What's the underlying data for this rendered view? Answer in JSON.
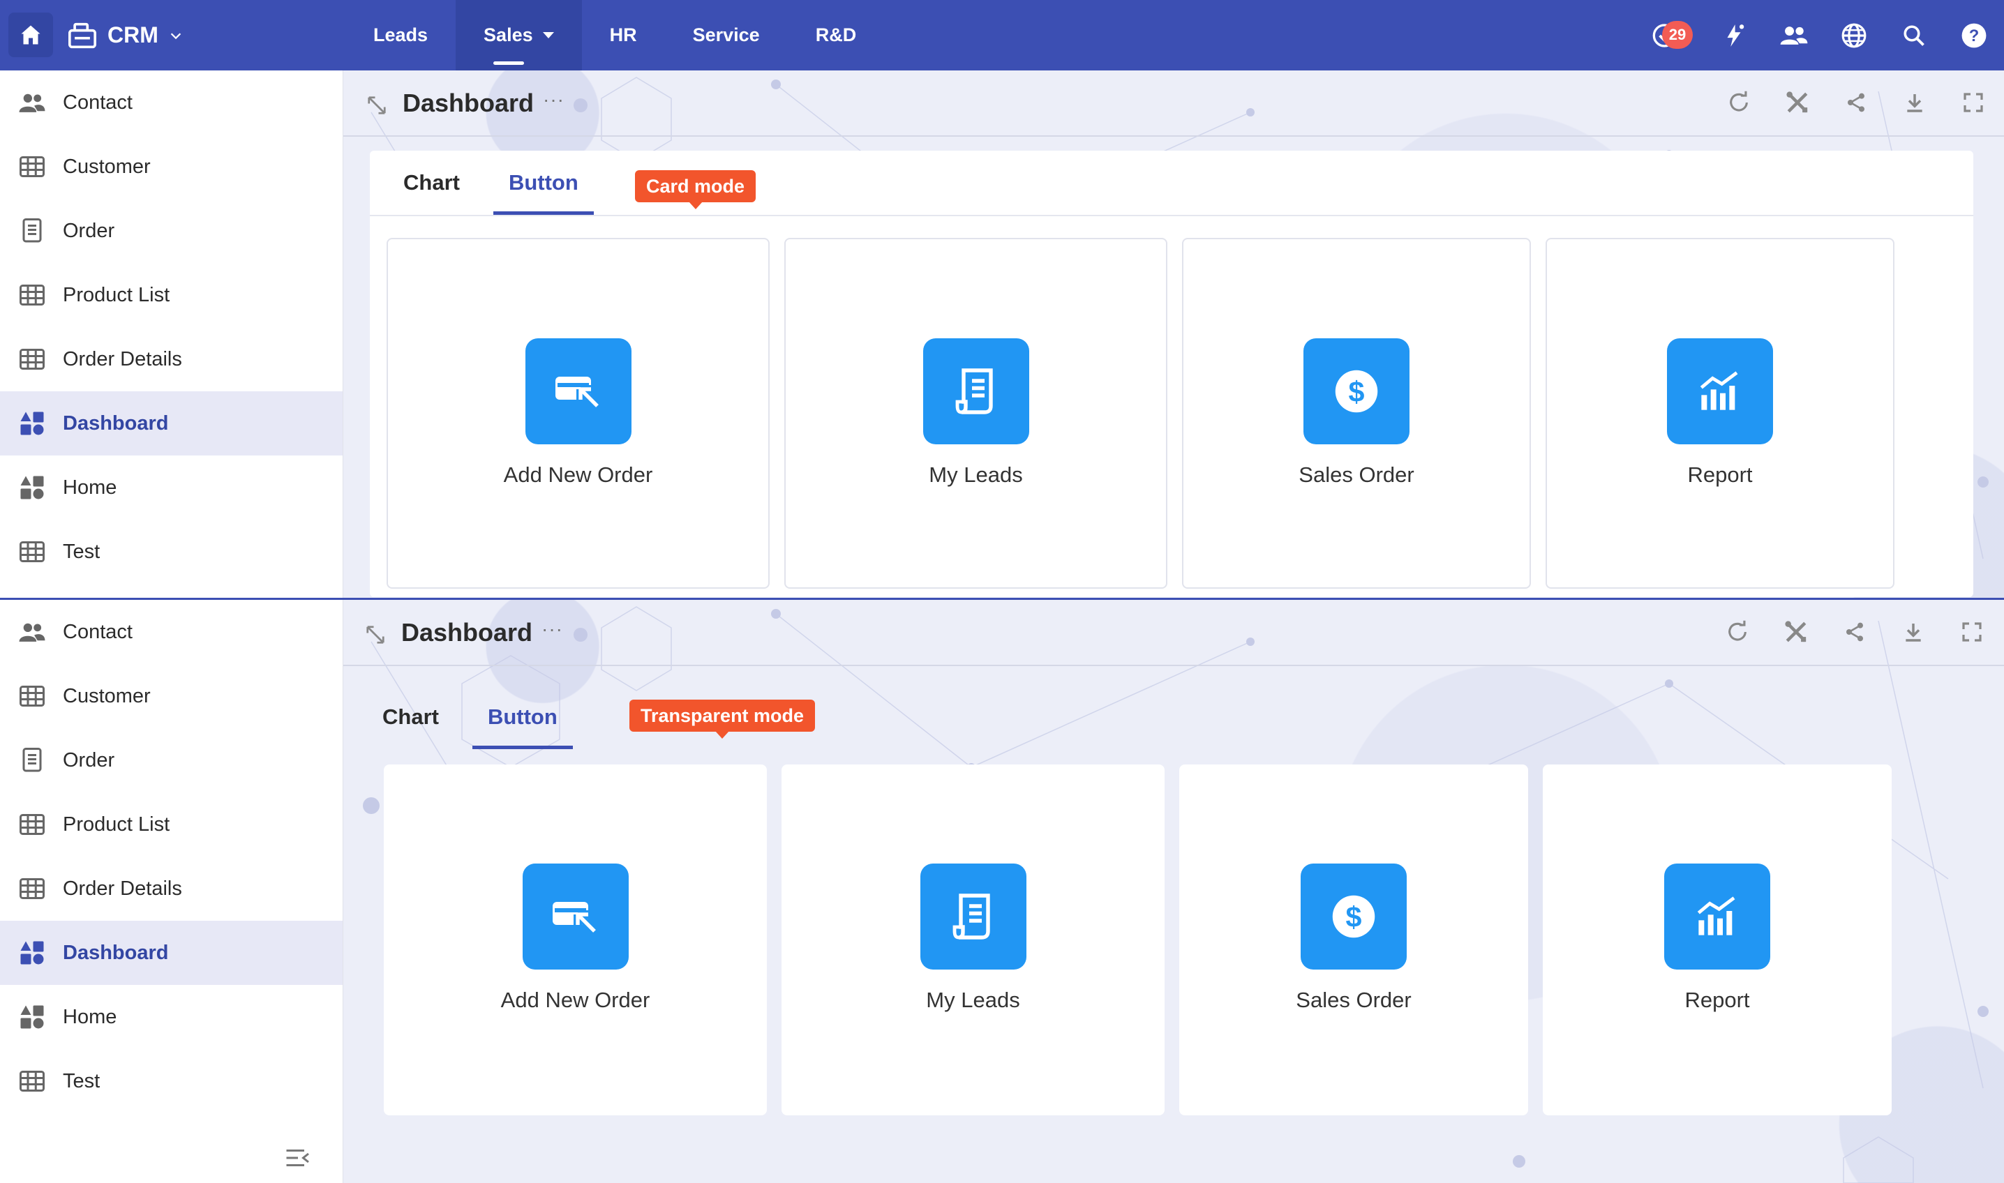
{
  "app": {
    "name": "CRM",
    "notifications_count": "29"
  },
  "topnav": {
    "items": [
      {
        "label": "Leads"
      },
      {
        "label": "Sales"
      },
      {
        "label": "HR"
      },
      {
        "label": "Service"
      },
      {
        "label": "R&D"
      }
    ],
    "active": "Sales",
    "right_icons": [
      "todo-check-icon",
      "flash-icon",
      "users-icon",
      "globe-icon",
      "search-icon",
      "help-icon"
    ]
  },
  "sidebar": {
    "items": [
      {
        "label": "Contact",
        "icon": "contacts-icon"
      },
      {
        "label": "Customer",
        "icon": "table-icon"
      },
      {
        "label": "Order",
        "icon": "document-icon"
      },
      {
        "label": "Product List",
        "icon": "table-icon"
      },
      {
        "label": "Order Details",
        "icon": "table-icon"
      },
      {
        "label": "Dashboard",
        "icon": "dashboard-icon"
      },
      {
        "label": "Home",
        "icon": "dashboard-icon"
      },
      {
        "label": "Test",
        "icon": "table-icon"
      }
    ],
    "active": "Dashboard"
  },
  "dashboard": {
    "title": "Dashboard",
    "more": "···",
    "actions": [
      "refresh-icon",
      "tools-icon",
      "share-icon",
      "download-icon",
      "fullscreen-icon"
    ]
  },
  "panel_card": {
    "tabs": [
      {
        "label": "Chart"
      },
      {
        "label": "Button"
      }
    ],
    "active_tab": "Button",
    "tooltip": "Card mode"
  },
  "panel_transparent": {
    "tabs": [
      {
        "label": "Chart"
      },
      {
        "label": "Button"
      }
    ],
    "active_tab": "Button",
    "tooltip": "Transparent mode"
  },
  "buttons": [
    {
      "label": "Add New Order",
      "icon": "add-order-icon"
    },
    {
      "label": "My Leads",
      "icon": "leads-document-icon"
    },
    {
      "label": "Sales Order",
      "icon": "dollar-icon"
    },
    {
      "label": "Report",
      "icon": "chart-icon"
    }
  ],
  "colors": {
    "brand": "#3c4fb3",
    "accent": "#2196f3",
    "tooltip": "#f2552c",
    "badge": "#f25c54"
  }
}
